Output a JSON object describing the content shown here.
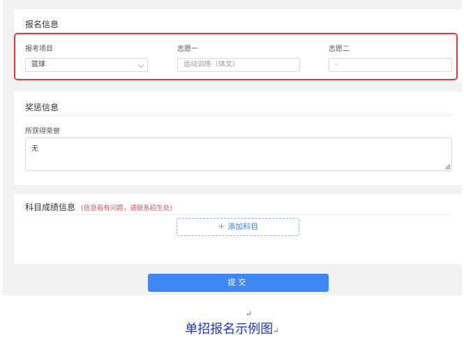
{
  "registration": {
    "title": "报名信息",
    "exam_project_label": "报考项目",
    "exam_project_value": "篮球",
    "wish1_label": "志愿一",
    "wish1_placeholder": "运动训练（体文）",
    "wish2_label": "志愿二",
    "wish2_value": "-"
  },
  "awards": {
    "title": "奖惩信息",
    "honors_label": "所获得荣誉",
    "honors_value": "无"
  },
  "scores": {
    "title": "科目成绩信息",
    "note": "(信息若有问题，请联系招生处)",
    "add_button": "＋ 添加科目"
  },
  "submit_label": "提交",
  "paragraph_mark": "↵",
  "caption": "单招报名示例图",
  "colors": {
    "accent": "#3f87f5",
    "highlight": "#e83535",
    "note": "#e55050",
    "caption": "#1a33d8"
  }
}
